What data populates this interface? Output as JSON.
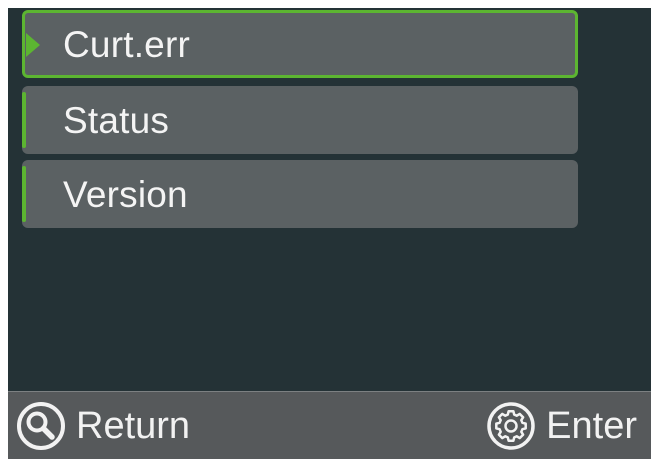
{
  "menu": {
    "items": [
      {
        "label": "Curt.err",
        "selected": true
      },
      {
        "label": "Status",
        "selected": false
      },
      {
        "label": "Version",
        "selected": false
      }
    ]
  },
  "footer": {
    "return_label": "Return",
    "return_icon": "magnifier-icon",
    "enter_label": "Enter",
    "enter_icon": "gear-icon"
  },
  "colors": {
    "accent": "#5cb531",
    "screen_background": "#243236",
    "item_background": "#5b6163",
    "footer_background": "#56595b",
    "text": "#f4f4f4"
  }
}
